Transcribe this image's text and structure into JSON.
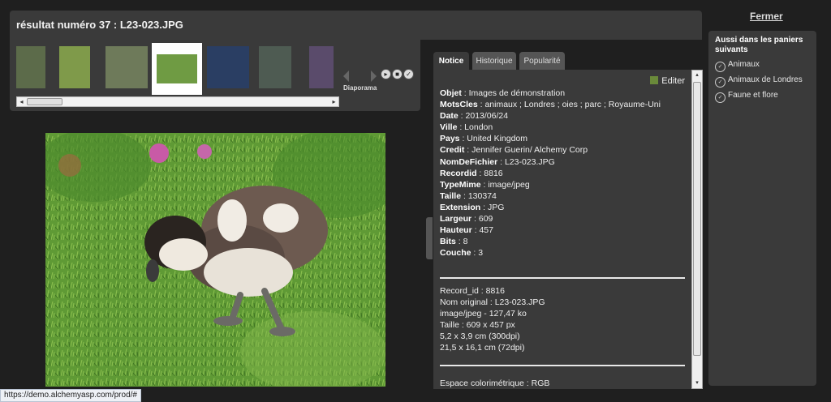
{
  "header": {
    "title": "résultat numéro 37 : L23-023.JPG"
  },
  "strip": {
    "thumbnails": [
      {
        "name": "thumb-1",
        "color": "#5c6b4a"
      },
      {
        "name": "thumb-2",
        "color": "#7f9a4a"
      },
      {
        "name": "thumb-3",
        "color": "#6e7a5a"
      },
      {
        "name": "thumb-4",
        "color": "#6f9b43",
        "selected": true
      },
      {
        "name": "thumb-5",
        "color": "#2a3e63"
      },
      {
        "name": "thumb-6",
        "color": "#4e5b52"
      },
      {
        "name": "thumb-7",
        "color": "#5a4b6b"
      }
    ],
    "slideshow_label": "Diaporama"
  },
  "tabs": [
    {
      "label": "Notice",
      "active": true
    },
    {
      "label": "Historique",
      "active": false
    },
    {
      "label": "Popularité",
      "active": false
    }
  ],
  "panel": {
    "edit_label": "Editer",
    "fields": [
      {
        "key": "Objet",
        "value": "Images de démonstration"
      },
      {
        "key": "MotsCles",
        "value": "animaux ; Londres ; oies ; parc ; Royaume-Uni"
      },
      {
        "key": "Date",
        "value": "2013/06/24"
      },
      {
        "key": "Ville",
        "value": "London"
      },
      {
        "key": "Pays",
        "value": "United Kingdom"
      },
      {
        "key": "Credit",
        "value": "Jennifer Guerin/ Alchemy Corp"
      },
      {
        "key": "NomDeFichier",
        "value": "L23-023.JPG"
      },
      {
        "key": "Recordid",
        "value": "8816"
      },
      {
        "key": "TypeMime",
        "value": "image/jpeg"
      },
      {
        "key": "Taille",
        "value": "130374"
      },
      {
        "key": "Extension",
        "value": "JPG"
      },
      {
        "key": "Largeur",
        "value": "609"
      },
      {
        "key": "Hauteur",
        "value": "457"
      },
      {
        "key": "Bits",
        "value": "8"
      },
      {
        "key": "Couche",
        "value": "3"
      }
    ],
    "meta": [
      "Record_id : 8816",
      "Nom original : L23-023.JPG",
      "image/jpeg - 127,47 ko",
      "Taille : 609 x 457 px",
      "5,2 x 3,9 cm (300dpi)",
      "21,5 x 16,1 cm (72dpi)"
    ],
    "extra": "Espace colorimétrique : RGB"
  },
  "sidebar": {
    "close_label": "Fermer",
    "heading": "Aussi dans les paniers suivants",
    "baskets": [
      "Animaux",
      "Animaux de Londres",
      "Faune et flore"
    ]
  },
  "status": {
    "url": "https://demo.alchemyasp.com/prod/#"
  },
  "colors": {
    "panel": "#3a3a3a",
    "background": "#1f1f1f",
    "accent": "#ffffff"
  }
}
